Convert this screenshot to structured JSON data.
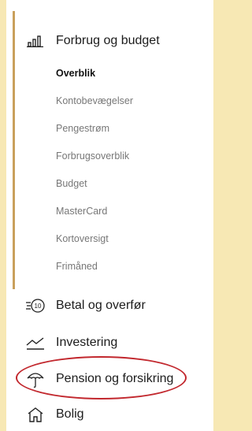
{
  "sections": {
    "forbrug": {
      "label": "Forbrug og budget",
      "icon": "bar-chart-icon"
    },
    "betal": {
      "label": "Betal og overfør",
      "icon": "coin-transfer-icon"
    },
    "investering": {
      "label": "Investering",
      "icon": "trend-line-icon"
    },
    "pension": {
      "label": "Pension og forsikring",
      "icon": "umbrella-icon"
    },
    "bolig": {
      "label": "Bolig",
      "icon": "house-icon"
    }
  },
  "sub_items": [
    {
      "label": "Overblik",
      "active": true
    },
    {
      "label": "Kontobevægelser",
      "active": false
    },
    {
      "label": "Pengestrøm",
      "active": false
    },
    {
      "label": "Forbrugsoverblik",
      "active": false
    },
    {
      "label": "Budget",
      "active": false
    },
    {
      "label": "MasterCard",
      "active": false
    },
    {
      "label": "Kortoversigt",
      "active": false
    },
    {
      "label": "Frimåned",
      "active": false
    }
  ],
  "coin_icon_text": "10",
  "colors": {
    "background": "#f7e8b4",
    "accent_bar": "#c9a05c",
    "highlight_ring": "#c2282e"
  }
}
